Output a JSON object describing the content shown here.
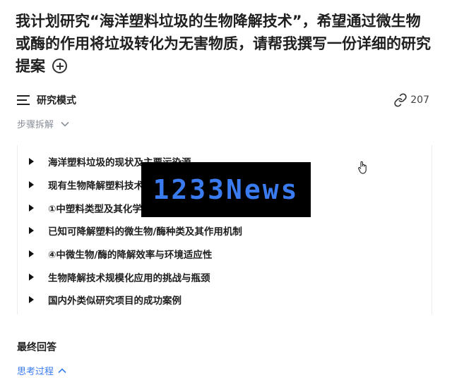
{
  "question": {
    "text": "我计划研究“海洋塑料垃圾的生物降解技术”，希望通过微生物或酶的作用将垃圾转化为无害物质，请帮我撰写一份详细的研究提案"
  },
  "mode_bar": {
    "label": "研究模式",
    "link_count": "207"
  },
  "steps_toggle": {
    "label": "步骤拆解"
  },
  "steps": [
    "海洋塑料垃圾的现状及主要污染源",
    "现有生物降解塑料技术",
    "①中塑料类型及其化学结构",
    "已知可降解塑料的微生物/酶种类及其作用机制",
    "④中微生物/酶的降解效率与环境适应性",
    "生物降解技术规模化应用的挑战与瓶颈",
    "国内外类似研究项目的成功案例"
  ],
  "watermark": {
    "text": "1233News"
  },
  "final": {
    "title": "最终回答"
  },
  "thinking_toggle": {
    "label": "思考过程"
  },
  "colors": {
    "accent": "#3a7bf0",
    "muted": "#8a8f99",
    "text": "#1f1f1f"
  },
  "icons": [
    "plus-circle-icon",
    "menu-lines-icon",
    "link-icon",
    "chevron-down-icon",
    "triangle-right-icon",
    "chevron-up-icon",
    "hand-pointer-icon"
  ]
}
